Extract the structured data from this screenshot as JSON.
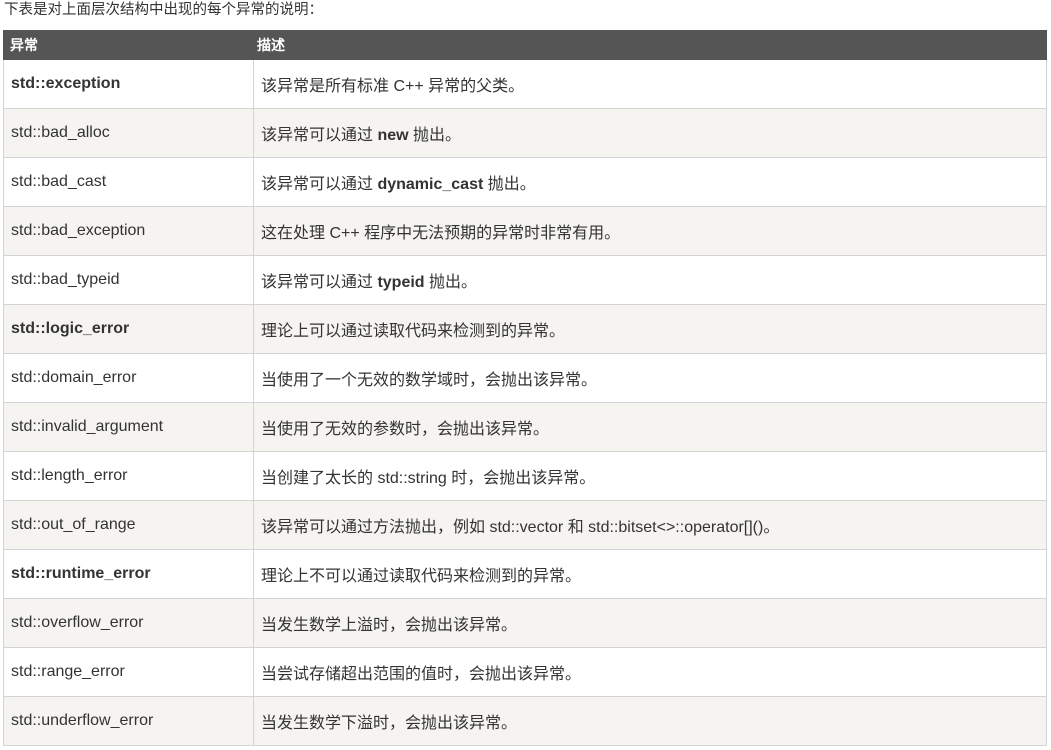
{
  "intro": "下表是对上面层次结构中出现的每个异常的说明：",
  "table": {
    "headers": [
      "异常",
      "描述"
    ],
    "rows": [
      {
        "name": "std::exception",
        "bold": true,
        "desc": [
          {
            "t": "该异常是所有标准 C++ 异常的父类。"
          }
        ]
      },
      {
        "name": "std::bad_alloc",
        "bold": false,
        "desc": [
          {
            "t": "该异常可以通过 "
          },
          {
            "t": "new",
            "b": true
          },
          {
            "t": " 抛出。"
          }
        ]
      },
      {
        "name": "std::bad_cast",
        "bold": false,
        "desc": [
          {
            "t": "该异常可以通过 "
          },
          {
            "t": "dynamic_cast",
            "b": true
          },
          {
            "t": " 抛出。"
          }
        ]
      },
      {
        "name": "std::bad_exception",
        "bold": false,
        "desc": [
          {
            "t": "这在处理 C++ 程序中无法预期的异常时非常有用。"
          }
        ]
      },
      {
        "name": "std::bad_typeid",
        "bold": false,
        "desc": [
          {
            "t": "该异常可以通过 "
          },
          {
            "t": "typeid",
            "b": true
          },
          {
            "t": " 抛出。"
          }
        ]
      },
      {
        "name": "std::logic_error",
        "bold": true,
        "desc": [
          {
            "t": "理论上可以通过读取代码来检测到的异常。"
          }
        ]
      },
      {
        "name": "std::domain_error",
        "bold": false,
        "desc": [
          {
            "t": "当使用了一个无效的数学域时，会抛出该异常。"
          }
        ]
      },
      {
        "name": "std::invalid_argument",
        "bold": false,
        "desc": [
          {
            "t": "当使用了无效的参数时，会抛出该异常。"
          }
        ]
      },
      {
        "name": "std::length_error",
        "bold": false,
        "desc": [
          {
            "t": "当创建了太长的 std::string 时，会抛出该异常。"
          }
        ]
      },
      {
        "name": "std::out_of_range",
        "bold": false,
        "desc": [
          {
            "t": "该异常可以通过方法抛出，例如 std::vector 和 std::bitset<>::operator[]()。"
          }
        ]
      },
      {
        "name": "std::runtime_error",
        "bold": true,
        "desc": [
          {
            "t": "理论上不可以通过读取代码来检测到的异常。"
          }
        ]
      },
      {
        "name": "std::overflow_error",
        "bold": false,
        "desc": [
          {
            "t": "当发生数学上溢时，会抛出该异常。"
          }
        ]
      },
      {
        "name": "std::range_error",
        "bold": false,
        "desc": [
          {
            "t": "当尝试存储超出范围的值时，会抛出该异常。"
          }
        ]
      },
      {
        "name": "std::underflow_error",
        "bold": false,
        "desc": [
          {
            "t": "当发生数学下溢时，会抛出该异常。"
          }
        ]
      }
    ]
  },
  "colors": {
    "header_bg": "#555555",
    "header_text": "#ffffff",
    "row_alt_bg": "#f6f4f0",
    "border": "#d4d4d4",
    "text": "#333333"
  }
}
